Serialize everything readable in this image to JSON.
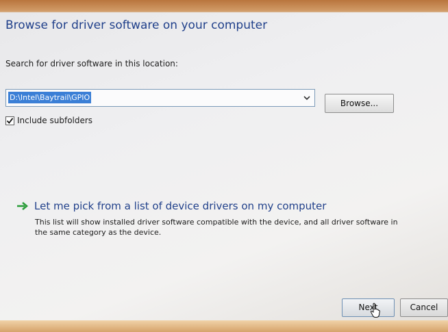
{
  "dialog": {
    "title": "Browse for driver software on your computer",
    "search_label": "Search for driver software in this location:",
    "path_value": "D:\\Intel\\Baytrail\\GPIO",
    "dropdown_icon": "chevron-down-icon",
    "browse_label": "Browse...",
    "include_subfolders": {
      "label": "Include subfolders",
      "checked": true
    },
    "pick_option": {
      "icon": "green-arrow-icon",
      "title": "Let me pick from a list of device drivers on my computer",
      "description": "This list will show installed driver software compatible with the device, and all driver software in the same category as the device."
    },
    "next_label": "Next",
    "cancel_label": "Cancel"
  },
  "colors": {
    "heading": "#1f3f8a",
    "selection": "#3b7fd6",
    "arrow": "#2a9d3a"
  }
}
